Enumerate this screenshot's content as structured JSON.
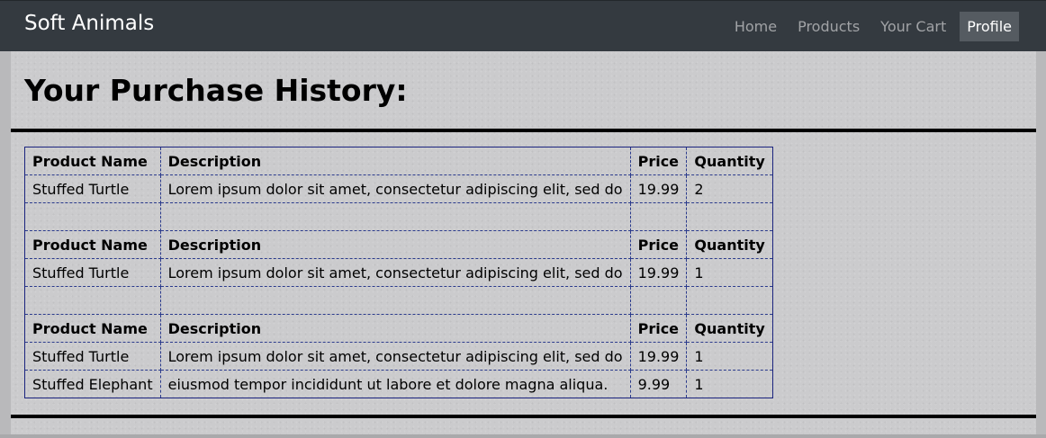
{
  "navbar": {
    "brand": "Soft Animals",
    "links": [
      {
        "label": "Home",
        "active": false
      },
      {
        "label": "Products",
        "active": false
      },
      {
        "label": "Your Cart",
        "active": false
      },
      {
        "label": "Profile",
        "active": true
      }
    ]
  },
  "page": {
    "title": "Your Purchase History:"
  },
  "table": {
    "headers": {
      "name": "Product Name",
      "description": "Description",
      "price": "Price",
      "quantity": "Quantity"
    },
    "orders": [
      {
        "items": [
          {
            "name": "Stuffed Turtle",
            "description": "Lorem ipsum dolor sit amet, consectetur adipiscing elit, sed do",
            "price": "19.99",
            "quantity": "2"
          }
        ]
      },
      {
        "items": [
          {
            "name": "Stuffed Turtle",
            "description": "Lorem ipsum dolor sit amet, consectetur adipiscing elit, sed do",
            "price": "19.99",
            "quantity": "1"
          }
        ]
      },
      {
        "items": [
          {
            "name": "Stuffed Turtle",
            "description": "Lorem ipsum dolor sit amet, consectetur adipiscing elit, sed do",
            "price": "19.99",
            "quantity": "1"
          },
          {
            "name": "Stuffed Elephant",
            "description": "eiusmod tempor incididunt ut labore et dolore magna aliqua.",
            "price": "9.99",
            "quantity": "1"
          }
        ]
      }
    ]
  },
  "colors": {
    "navbar_bg": "#343a40",
    "nav_link": "#a1a3a6",
    "nav_active_bg": "#555b61",
    "table_border": "#1a237e"
  }
}
